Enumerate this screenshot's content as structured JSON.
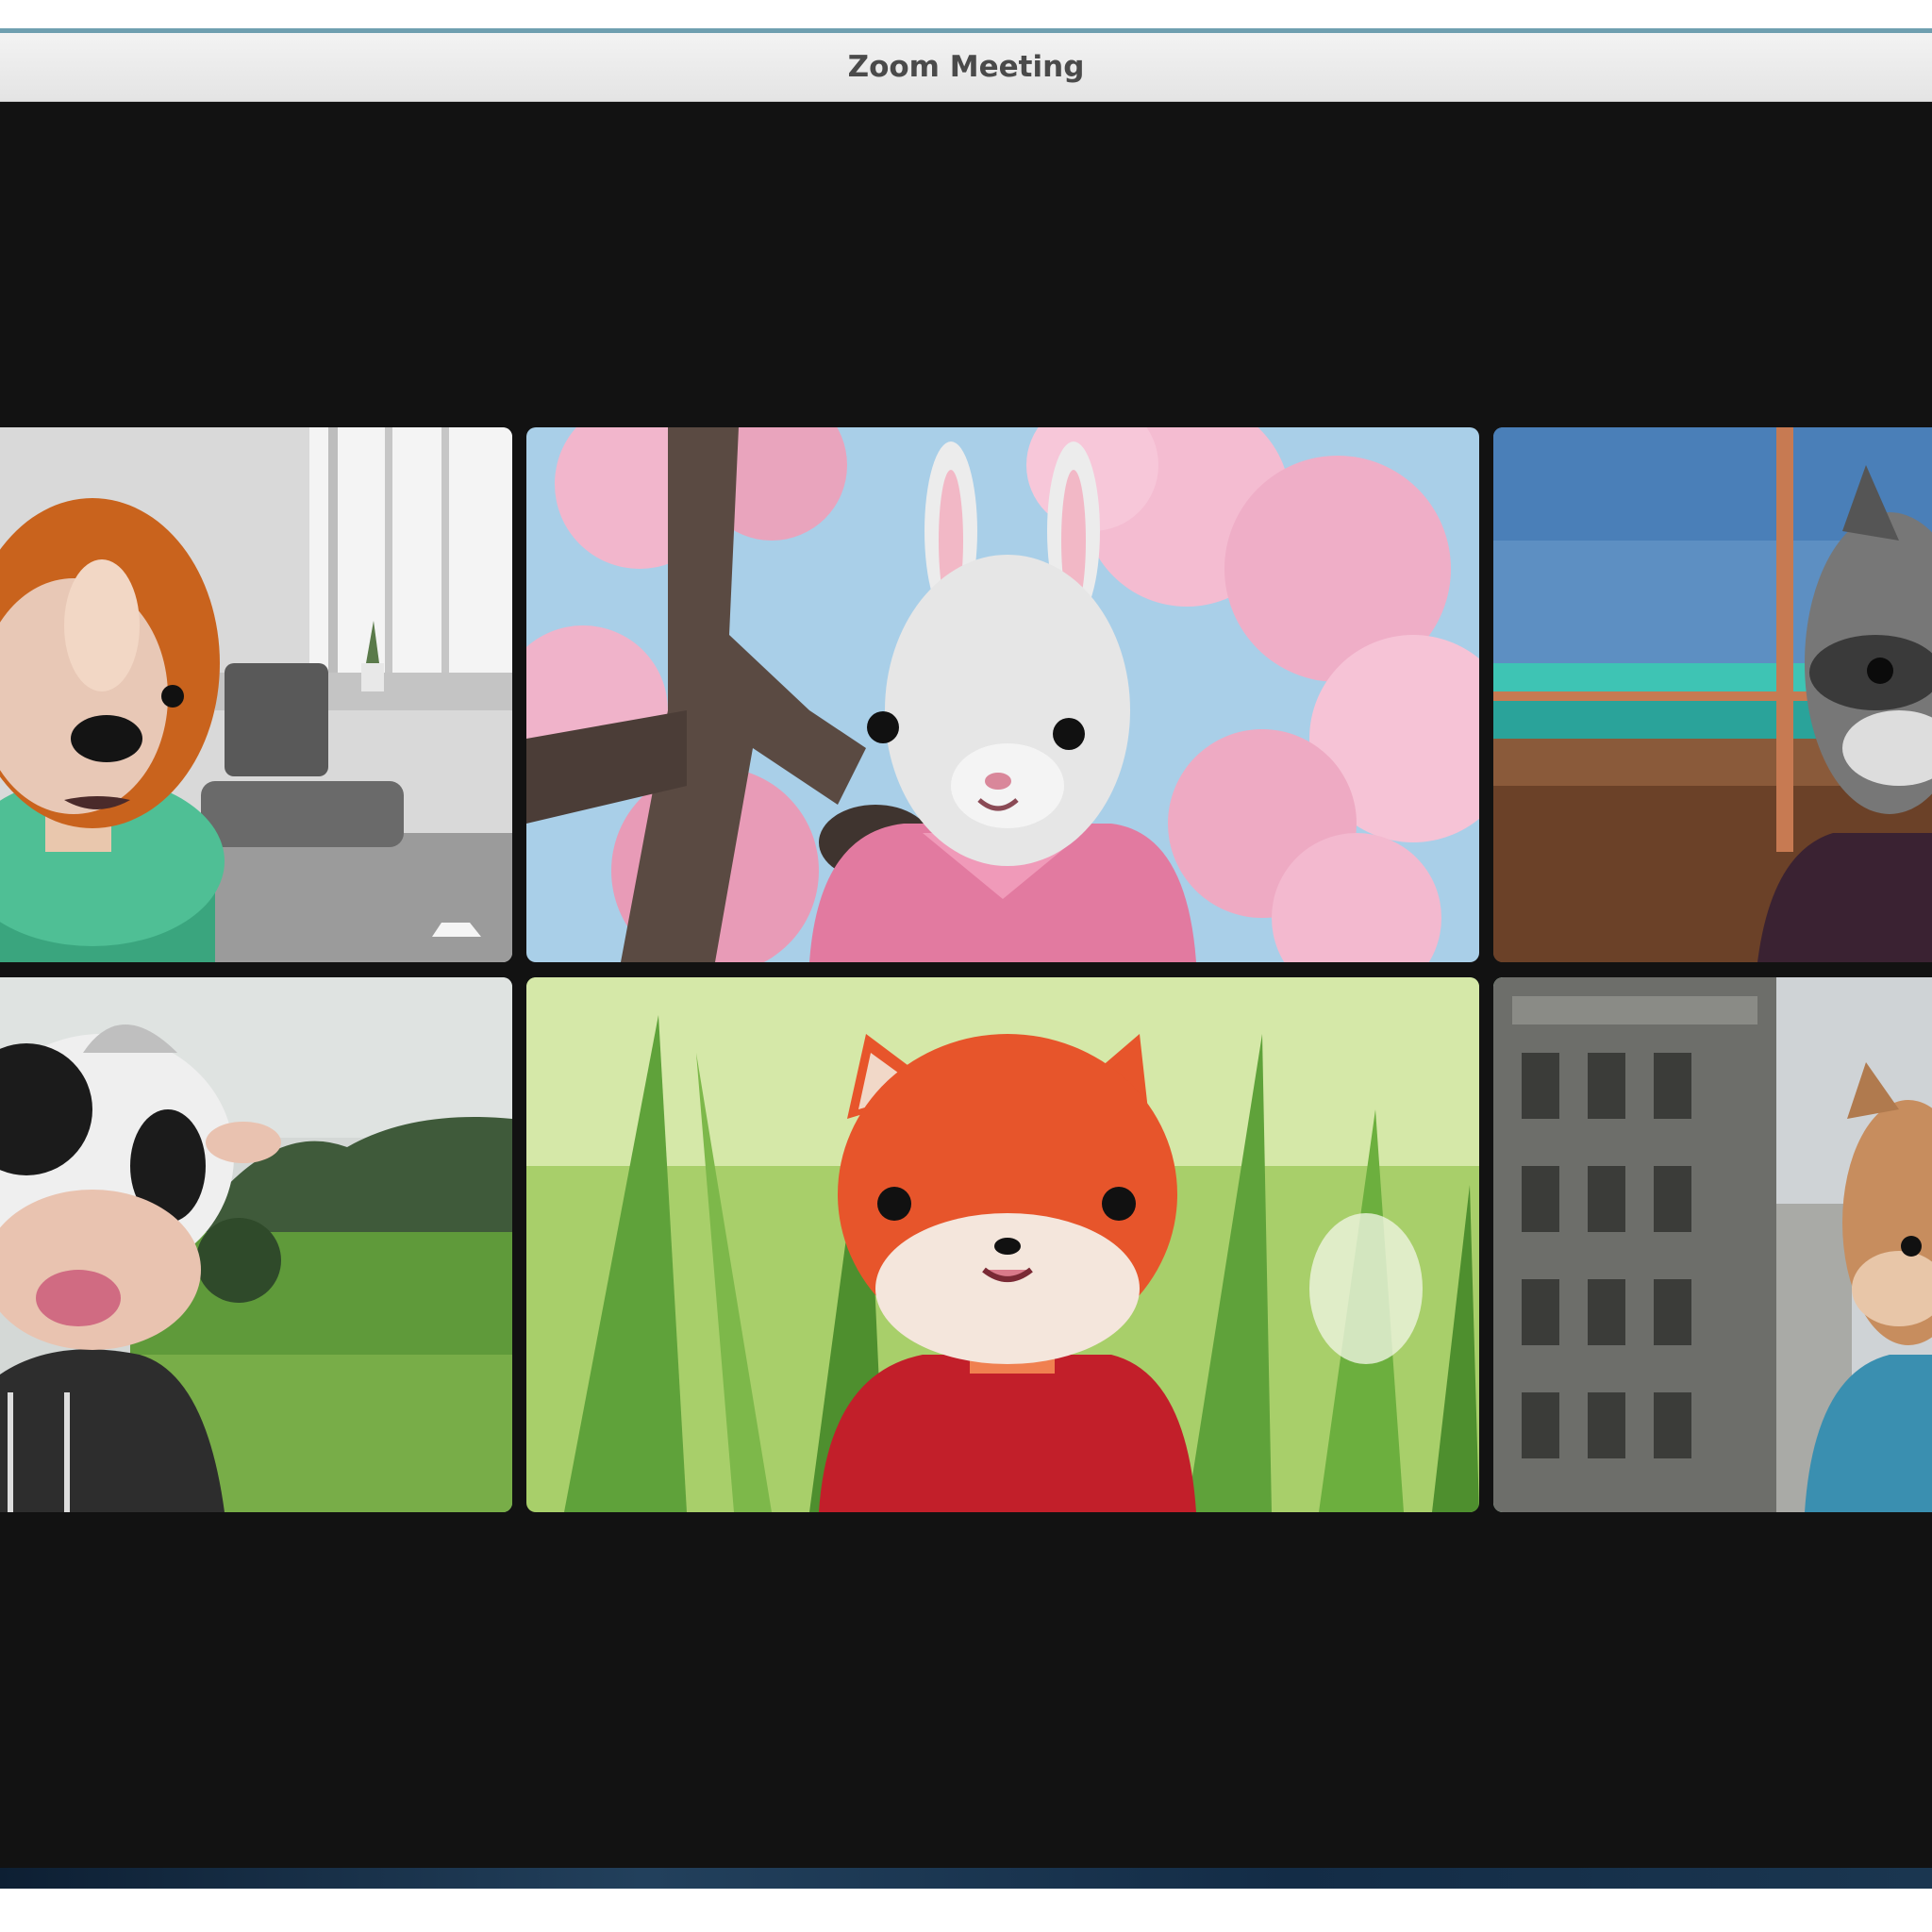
{
  "window": {
    "title": "Zoom Meeting"
  },
  "participants": [
    {
      "avatar": "dog-avatar-icon",
      "background": "living-room",
      "active": false
    },
    {
      "avatar": "rabbit-avatar-icon",
      "background": "cherry-blossoms",
      "active": false
    },
    {
      "avatar": "raccoon-avatar-icon",
      "background": "ocean-view",
      "active": false
    },
    {
      "avatar": "cow-avatar-icon",
      "background": "green-hills",
      "active": false
    },
    {
      "avatar": "fox-avatar-icon",
      "background": "grass-field",
      "active": false
    },
    {
      "avatar": "cat-avatar-icon",
      "background": "city-buildings",
      "active": true
    }
  ],
  "colors": {
    "active_speaker_border": "#2fc24a",
    "stage_background": "#121212"
  }
}
